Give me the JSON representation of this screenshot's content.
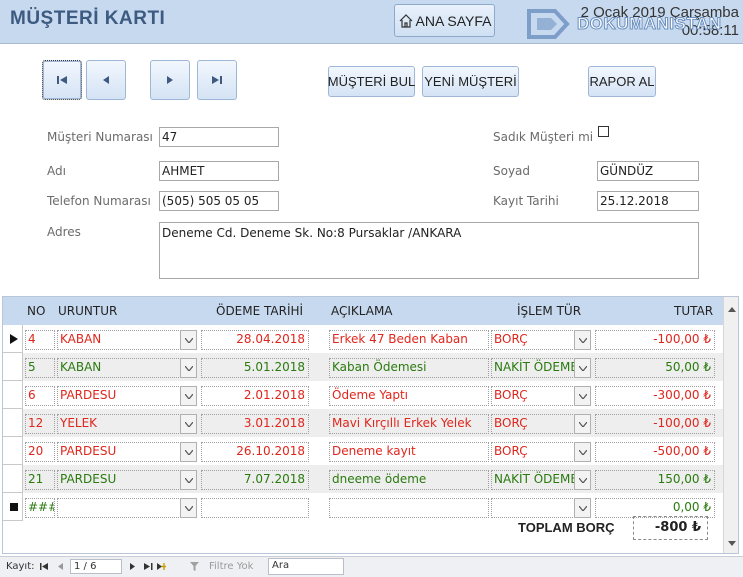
{
  "header": {
    "title": "MÜŞTERİ KARTI",
    "home_button": "ANA SAYFA",
    "date": "2 Ocak 2019 Çarşamba",
    "time": "00:58:11",
    "watermark_text": "DOKUMANISTAN"
  },
  "toolbar": {
    "find_customer": "MÜŞTERİ BUL",
    "new_customer": "YENİ MÜŞTERİ",
    "report": "RAPOR AL"
  },
  "form": {
    "customer_no_label": "Müşteri Numarası",
    "customer_no": "47",
    "loyal_label": "Sadık Müşteri mi",
    "loyal_checked": false,
    "name_label": "Adı",
    "name": "AHMET",
    "surname_label": "Soyad",
    "surname": "GÜNDÜZ",
    "phone_label": "Telefon Numarası",
    "phone": "(505) 505 05 05",
    "reg_date_label": "Kayıt Tarihi",
    "reg_date": "25.12.2018",
    "address_label": "Adres",
    "address": "Deneme Cd. Deneme Sk. No:8 Pursaklar /ANKARA"
  },
  "grid": {
    "columns": [
      "NO",
      "URUNTUR",
      "ÖDEME TARİHİ",
      "AÇIKLAMA",
      "İŞLEM TÜR",
      "TUTAR"
    ],
    "rows": [
      {
        "no": "4",
        "product": "KABAN",
        "date": "28.04.2018",
        "desc": "Erkek 47 Beden Kaban",
        "type": "BORÇ",
        "amount": "-100,00 ₺",
        "color": "red"
      },
      {
        "no": "5",
        "product": "KABAN",
        "date": "5.01.2018",
        "desc": "Kaban Ödemesi",
        "type": "NAKİT ÖDEME",
        "amount": "50,00 ₺",
        "color": "green"
      },
      {
        "no": "6",
        "product": "PARDESU",
        "date": "2.01.2018",
        "desc": "Ödeme Yaptı",
        "type": "BORÇ",
        "amount": "-300,00 ₺",
        "color": "red"
      },
      {
        "no": "12",
        "product": "YELEK",
        "date": "3.01.2018",
        "desc": "Mavi Kırçıllı Erkek Yelek",
        "type": "BORÇ",
        "amount": "-100,00 ₺",
        "color": "red"
      },
      {
        "no": "20",
        "product": "PARDESU",
        "date": "26.10.2018",
        "desc": "Deneme kayıt",
        "type": "BORÇ",
        "amount": "-500,00 ₺",
        "color": "red"
      },
      {
        "no": "21",
        "product": "PARDESU",
        "date": "7.07.2018",
        "desc": "dneeme ödeme",
        "type": "NAKİT ÖDEME",
        "amount": "150,00 ₺",
        "color": "green"
      }
    ],
    "new_row_no": "###",
    "new_row_amount": "0,00 ₺",
    "total_label": "TOPLAM BORÇ",
    "total_value": "-800 ₺"
  },
  "navigator": {
    "record_label": "Kayıt:",
    "record_position": "1 / 6",
    "filter_label": "Filtre Yok",
    "search_placeholder": "Ara"
  },
  "colors": {
    "header_bg": "#c7d9ef",
    "debt": "#e0261c",
    "payment": "#2a7a0e"
  }
}
